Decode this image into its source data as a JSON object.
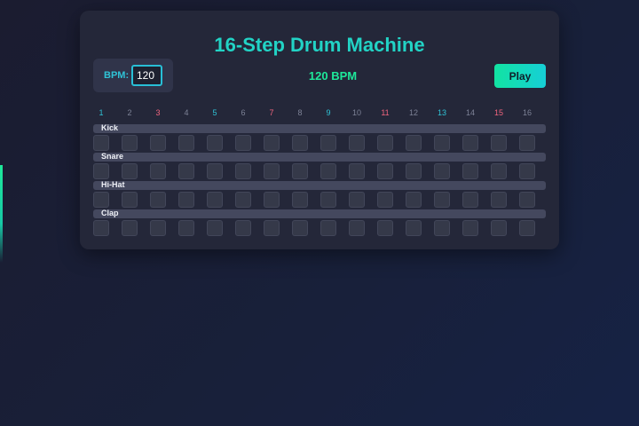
{
  "app": {
    "title": "16-Step Drum Machine"
  },
  "controls": {
    "bpm_label": "BPM:",
    "bpm_value": "120",
    "bpm_display": "120 BPM",
    "play_label": "Play"
  },
  "steps": [
    "1",
    "2",
    "3",
    "4",
    "5",
    "6",
    "7",
    "8",
    "9",
    "10",
    "11",
    "12",
    "13",
    "14",
    "15",
    "16"
  ],
  "step_colors": {
    "cyan": [
      0,
      4,
      8,
      12
    ],
    "pink": [
      2,
      6,
      10,
      14
    ]
  },
  "tracks": [
    {
      "name": "Kick",
      "pattern": [
        0,
        0,
        0,
        0,
        0,
        0,
        0,
        0,
        0,
        0,
        0,
        0,
        0,
        0,
        0,
        0
      ]
    },
    {
      "name": "Snare",
      "pattern": [
        0,
        0,
        0,
        0,
        0,
        0,
        0,
        0,
        0,
        0,
        0,
        0,
        0,
        0,
        0,
        0
      ]
    },
    {
      "name": "Hi-Hat",
      "pattern": [
        0,
        0,
        0,
        0,
        0,
        0,
        0,
        0,
        0,
        0,
        0,
        0,
        0,
        0,
        0,
        0
      ]
    },
    {
      "name": "Clap",
      "pattern": [
        0,
        0,
        0,
        0,
        0,
        0,
        0,
        0,
        0,
        0,
        0,
        0,
        0,
        0,
        0,
        0
      ]
    }
  ],
  "colors": {
    "accent_cyan": "#22d3c5",
    "accent_green": "#1ee89a",
    "step_pink": "#f0647e",
    "panel_bg": "#242739"
  }
}
